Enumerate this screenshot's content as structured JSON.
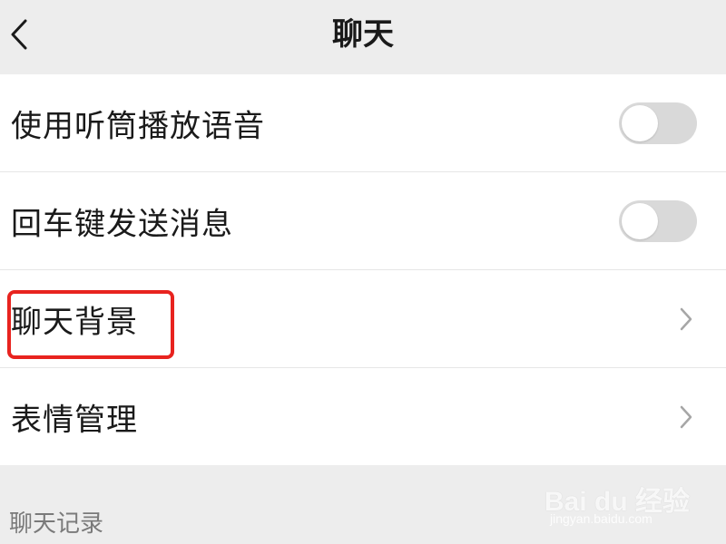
{
  "header": {
    "title": "聊天"
  },
  "settings": [
    {
      "label": "使用听筒播放语音",
      "control": "toggle",
      "on": false
    },
    {
      "label": "回车键发送消息",
      "control": "toggle",
      "on": false
    },
    {
      "label": "聊天背景",
      "control": "chevron"
    },
    {
      "label": "表情管理",
      "control": "chevron"
    }
  ],
  "section": {
    "label": "聊天记录"
  },
  "watermark": {
    "main": "Bai du 经验",
    "sub": "jingyan.baidu.com"
  },
  "colors": {
    "background": "#ededed",
    "row_background": "#ffffff",
    "toggle_off": "#d9d9d9",
    "highlight": "#e8231f"
  },
  "icons": {
    "back": "chevron-left-icon",
    "row_arrow": "chevron-right-icon"
  }
}
